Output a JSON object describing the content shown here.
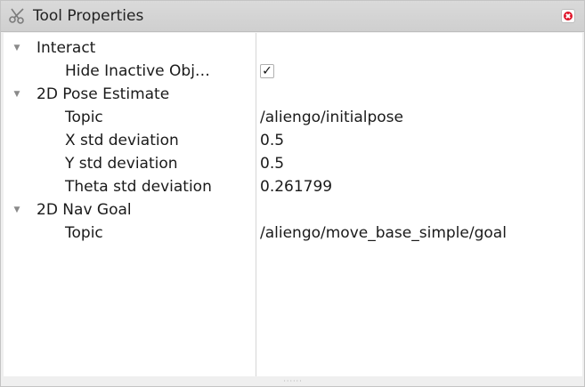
{
  "panel": {
    "title": "Tool Properties",
    "icon": "scissors-tool-icon",
    "close_icon": "close-icon"
  },
  "tree": [
    {
      "type": "category",
      "label": "Interact",
      "expanded": true
    },
    {
      "type": "property",
      "label": "Hide Inactive Obj…",
      "value": "✓",
      "checked": true
    },
    {
      "type": "category",
      "label": "2D Pose Estimate",
      "expanded": true
    },
    {
      "type": "property",
      "label": "Topic",
      "value": "/aliengo/initialpose"
    },
    {
      "type": "property",
      "label": "X std deviation",
      "value": "0.5"
    },
    {
      "type": "property",
      "label": "Y std deviation",
      "value": "0.5"
    },
    {
      "type": "property",
      "label": "Theta std deviation",
      "value": "0.261799"
    },
    {
      "type": "category",
      "label": "2D Nav Goal",
      "expanded": true
    },
    {
      "type": "property",
      "label": "Topic",
      "value": "/aliengo/move_base_simple/goal"
    }
  ],
  "colors": {
    "titlebar": "#d4d4d4",
    "close_red": "#e0162b",
    "tree_bg": "#ffffff"
  }
}
